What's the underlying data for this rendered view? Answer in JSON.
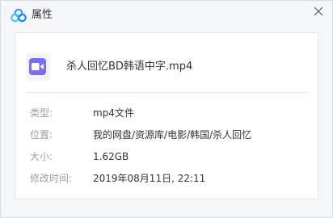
{
  "window": {
    "title": "属性",
    "logo_icon": "baidu-netdisk-cloud-icon",
    "close_icon": "close-icon"
  },
  "file": {
    "icon": "video-file-icon",
    "icon_color": "#7a6df2",
    "name": "杀人回忆BD韩语中字.mp4"
  },
  "properties": [
    {
      "label": "类型:",
      "value": "mp4文件"
    },
    {
      "label": "位置:",
      "value": "我的网盘/资源库/电影/韩国/杀人回忆"
    },
    {
      "label": "大小:",
      "value": "1.62GB"
    },
    {
      "label": "修改时间:",
      "value": "2019年08月11日, 22:11"
    }
  ]
}
